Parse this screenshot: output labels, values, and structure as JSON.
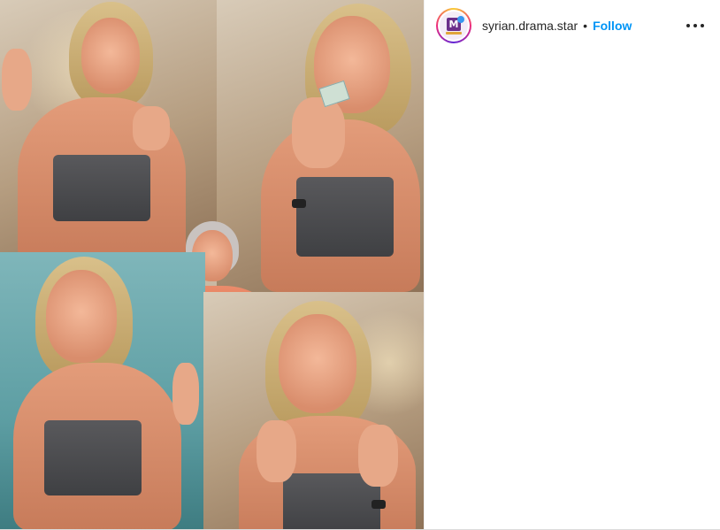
{
  "post": {
    "username": "syrian.drama.star",
    "separator": "•",
    "follow_label": "Follow",
    "more_icon": "more-horizontal-icon",
    "avatar_icon": "profile-avatar",
    "verified_color": "#3897f0",
    "follow_color": "#0095f6"
  }
}
